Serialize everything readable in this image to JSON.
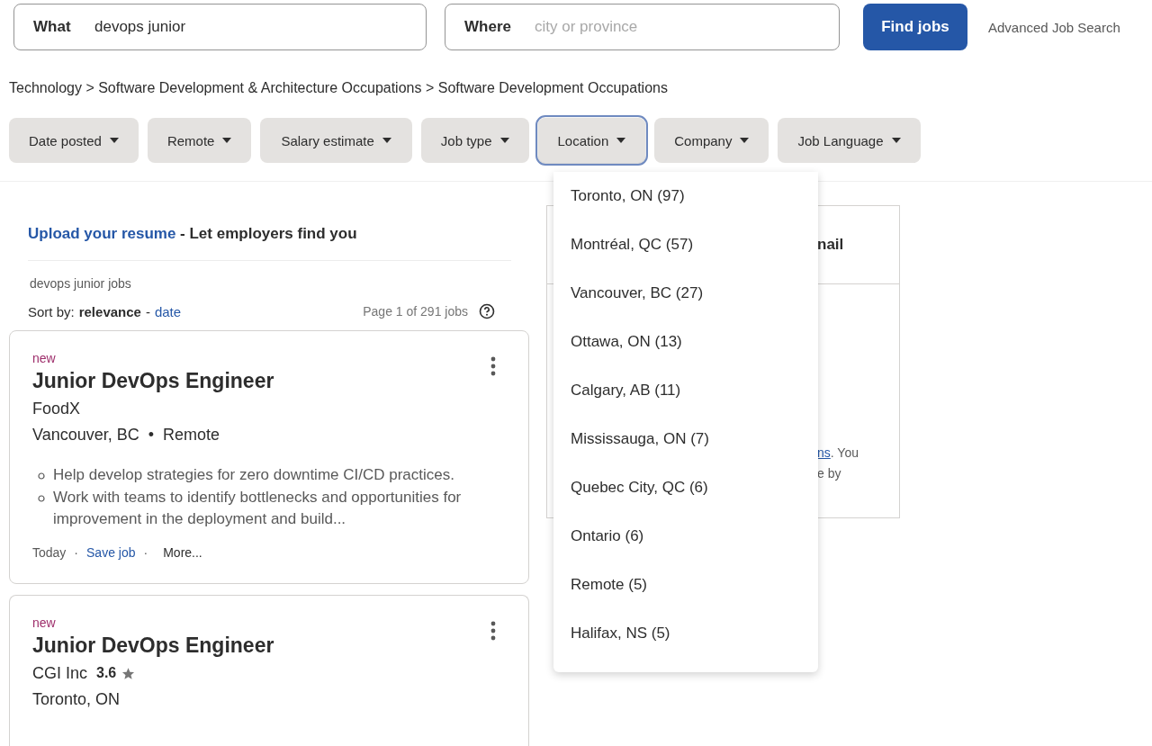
{
  "search": {
    "what": {
      "label": "What",
      "value": "devops junior"
    },
    "where": {
      "label": "Where",
      "placeholder": "city or province"
    },
    "find_button": "Find jobs",
    "advanced_link": "Advanced Job Search"
  },
  "breadcrumb": "Technology > Software Development & Architecture Occupations > Software Development Occupations",
  "filters": [
    {
      "label": "Date posted",
      "expanded": false
    },
    {
      "label": "Remote",
      "expanded": false
    },
    {
      "label": "Salary estimate",
      "expanded": false
    },
    {
      "label": "Job type",
      "expanded": false
    },
    {
      "label": "Location",
      "expanded": true
    },
    {
      "label": "Company",
      "expanded": false
    },
    {
      "label": "Job Language",
      "expanded": false
    }
  ],
  "location_menu": [
    "Toronto, ON (97)",
    "Montréal, QC (57)",
    "Vancouver, BC (27)",
    "Ottawa, ON (13)",
    "Calgary, AB (11)",
    "Mississauga, ON (7)",
    "Quebec City, QC (6)",
    "Ontario (6)",
    "Remote (5)",
    "Halifax, NS (5)"
  ],
  "resume_banner": {
    "link": "Upload your resume",
    "text": " - Let employers find you"
  },
  "query_title": "devops junior jobs",
  "sort": {
    "label": "Sort by:",
    "separator": "-",
    "options": [
      {
        "label": "relevance",
        "selected": true
      },
      {
        "label": "date",
        "selected": false
      }
    ]
  },
  "page_count": "Page 1 of 291 jobs",
  "jobs": [
    {
      "badge": "new",
      "title": "Junior DevOps Engineer",
      "company": "FoodX",
      "location": [
        "Vancouver, BC",
        "Remote"
      ],
      "location_separator": "•",
      "snippets": [
        "Help develop strategies for zero downtime CI/CD practices.",
        "Work with teams to identify bottlenecks and opportunities for improvement in the deployment and build..."
      ],
      "footer": {
        "date": "Today",
        "save": "Save job",
        "more": "More...",
        "separator": "·"
      }
    },
    {
      "badge": "new",
      "title": "Junior DevOps Engineer",
      "company": "CGI Inc",
      "rating": "3.6",
      "location": [
        "Toronto, ON"
      ]
    }
  ],
  "alert_panel": {
    "heading_fragment": "nail",
    "link_fragment": "ns",
    "line_1_rest": ". You",
    "line_2": "e by"
  }
}
